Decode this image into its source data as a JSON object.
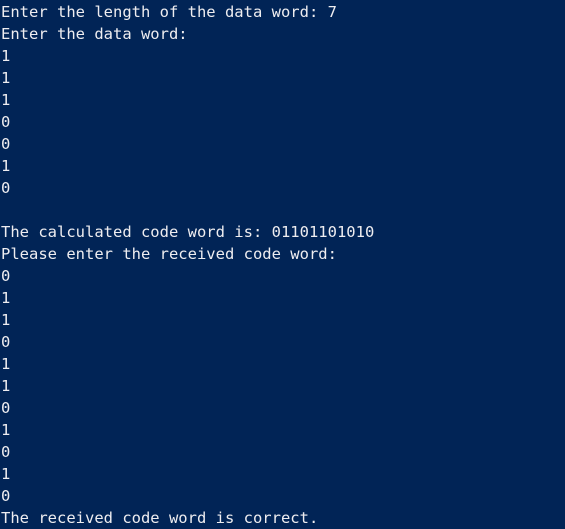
{
  "console": {
    "lines": [
      "Enter the length of the data word: 7",
      "Enter the data word:",
      "1",
      "1",
      "1",
      "0",
      "0",
      "1",
      "0",
      "",
      "The calculated code word is: 01101101010",
      "Please enter the received code word:",
      "0",
      "1",
      "1",
      "0",
      "1",
      "1",
      "0",
      "1",
      "0",
      "1",
      "0",
      "The received code word is correct."
    ]
  },
  "colors": {
    "background": "#012456",
    "foreground": "#eeedf0"
  }
}
